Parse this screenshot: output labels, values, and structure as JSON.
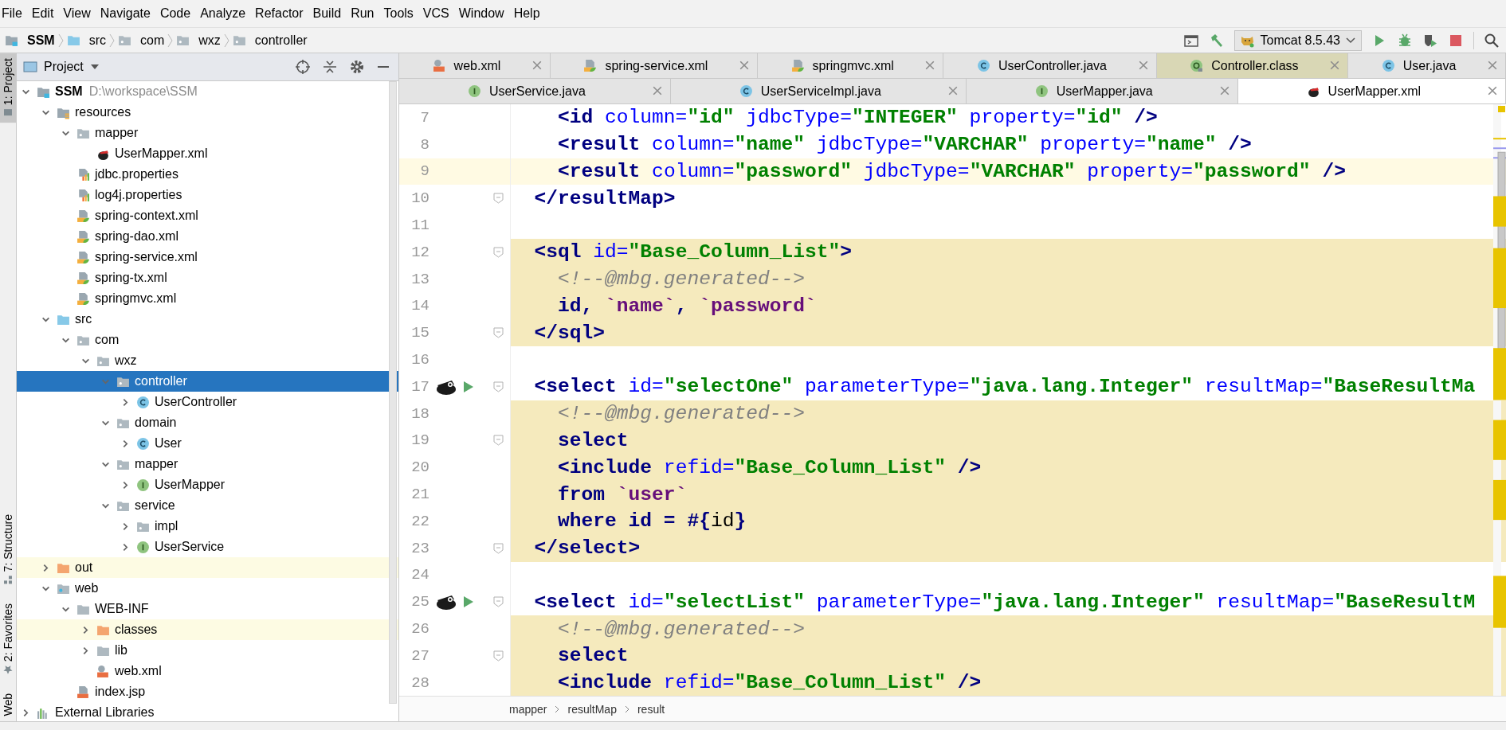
{
  "menu": [
    "File",
    "Edit",
    "View",
    "Navigate",
    "Code",
    "Analyze",
    "Refactor",
    "Build",
    "Run",
    "Tools",
    "VCS",
    "Window",
    "Help"
  ],
  "navigation": [
    {
      "label": "SSM",
      "kind": "module"
    },
    {
      "label": "src",
      "kind": "source_folder"
    },
    {
      "label": "com",
      "kind": "package"
    },
    {
      "label": "wxz",
      "kind": "package"
    },
    {
      "label": "controller",
      "kind": "package"
    }
  ],
  "run_configuration": {
    "label": "Tomcat 8.5.43"
  },
  "left_strip": {
    "top": [
      {
        "label": "1: Project",
        "selected": true
      }
    ],
    "bottom": [
      {
        "label": "7: Structure",
        "selected": false
      },
      {
        "label": "2: Favorites",
        "selected": false
      },
      {
        "label": "Web",
        "selected": false
      }
    ]
  },
  "project_panel": {
    "title": "Project",
    "tree": [
      {
        "label": "SSM",
        "path": "D:\\workspace\\SSM",
        "kind": "module",
        "expanded": true,
        "selected": false,
        "excluded": false,
        "children": [
          {
            "label": "resources",
            "kind": "resource_folder",
            "expanded": true,
            "selected": false,
            "excluded": false,
            "children": [
              {
                "label": "mapper",
                "kind": "package",
                "expanded": true,
                "selected": false,
                "excluded": false,
                "children": [
                  {
                    "label": "UserMapper.xml",
                    "kind": "mybatis_xml",
                    "selected": false,
                    "excluded": false
                  }
                ]
              },
              {
                "label": "jdbc.properties",
                "kind": "properties",
                "selected": false,
                "excluded": false
              },
              {
                "label": "log4j.properties",
                "kind": "properties",
                "selected": false,
                "excluded": false
              },
              {
                "label": "spring-context.xml",
                "kind": "spring_xml",
                "selected": false,
                "excluded": false
              },
              {
                "label": "spring-dao.xml",
                "kind": "spring_xml",
                "selected": false,
                "excluded": false
              },
              {
                "label": "spring-service.xml",
                "kind": "spring_xml",
                "selected": false,
                "excluded": false
              },
              {
                "label": "spring-tx.xml",
                "kind": "spring_xml",
                "selected": false,
                "excluded": false
              },
              {
                "label": "springmvc.xml",
                "kind": "spring_xml",
                "selected": false,
                "excluded": false
              }
            ]
          },
          {
            "label": "src",
            "kind": "source_folder",
            "expanded": true,
            "selected": false,
            "excluded": false,
            "children": [
              {
                "label": "com",
                "kind": "package",
                "expanded": true,
                "selected": false,
                "excluded": false,
                "children": [
                  {
                    "label": "wxz",
                    "kind": "package",
                    "expanded": true,
                    "selected": false,
                    "excluded": false,
                    "children": [
                      {
                        "label": "controller",
                        "kind": "package",
                        "expanded": true,
                        "selected": true,
                        "excluded": false,
                        "children": [
                          {
                            "label": "UserController",
                            "kind": "class",
                            "expanded": false,
                            "selected": false,
                            "excluded": false
                          }
                        ]
                      },
                      {
                        "label": "domain",
                        "kind": "package",
                        "expanded": true,
                        "selected": false,
                        "excluded": false,
                        "children": [
                          {
                            "label": "User",
                            "kind": "class",
                            "expanded": false,
                            "selected": false,
                            "excluded": false
                          }
                        ]
                      },
                      {
                        "label": "mapper",
                        "kind": "package",
                        "expanded": true,
                        "selected": false,
                        "excluded": false,
                        "children": [
                          {
                            "label": "UserMapper",
                            "kind": "interface",
                            "expanded": false,
                            "selected": false,
                            "excluded": false
                          }
                        ]
                      },
                      {
                        "label": "service",
                        "kind": "package",
                        "expanded": true,
                        "selected": false,
                        "excluded": false,
                        "children": [
                          {
                            "label": "impl",
                            "kind": "package",
                            "expanded": false,
                            "selected": false,
                            "excluded": false
                          },
                          {
                            "label": "UserService",
                            "kind": "interface",
                            "expanded": false,
                            "selected": false,
                            "excluded": false
                          }
                        ]
                      }
                    ]
                  }
                ]
              }
            ]
          },
          {
            "label": "out",
            "kind": "excluded_folder",
            "expanded": false,
            "selected": false,
            "excluded": true
          },
          {
            "label": "web",
            "kind": "web_folder",
            "expanded": true,
            "selected": false,
            "excluded": false,
            "children": [
              {
                "label": "WEB-INF",
                "kind": "folder",
                "expanded": true,
                "selected": false,
                "excluded": false,
                "children": [
                  {
                    "label": "classes",
                    "kind": "excluded_folder",
                    "expanded": false,
                    "selected": false,
                    "excluded": true
                  },
                  {
                    "label": "lib",
                    "kind": "folder",
                    "expanded": false,
                    "selected": false,
                    "excluded": false
                  },
                  {
                    "label": "web.xml",
                    "kind": "web_xml",
                    "selected": false,
                    "excluded": false
                  }
                ]
              },
              {
                "label": "index.jsp",
                "kind": "jsp",
                "selected": false,
                "excluded": false
              }
            ]
          }
        ]
      },
      {
        "label": "External Libraries",
        "kind": "libraries",
        "expanded": false,
        "selected": false,
        "excluded": false
      }
    ]
  },
  "editor": {
    "tab_rows": [
      [
        {
          "label": "web.xml",
          "kind": "web_xml",
          "selected": false
        },
        {
          "label": "spring-service.xml",
          "kind": "spring_xml",
          "selected": false
        },
        {
          "label": "springmvc.xml",
          "kind": "spring_xml",
          "selected": false
        },
        {
          "label": "UserController.java",
          "kind": "class",
          "selected": false
        },
        {
          "label": "Controller.class",
          "kind": "compiled_annotation",
          "selected": false
        },
        {
          "label": "User.java",
          "kind": "class",
          "selected": false
        }
      ],
      [
        {
          "label": "UserService.java",
          "kind": "interface",
          "selected": false
        },
        {
          "label": "UserServiceImpl.java",
          "kind": "class",
          "selected": false
        },
        {
          "label": "UserMapper.java",
          "kind": "interface",
          "selected": false
        },
        {
          "label": "UserMapper.xml",
          "kind": "mybatis_xml",
          "selected": true
        }
      ]
    ],
    "lines": [
      {
        "number": "7",
        "current_line": false,
        "sql_highlight": false,
        "fold_marker": false,
        "run_marker": false,
        "tokens": [
          {
            "kind": "tag",
            "text": "    <id"
          },
          {
            "kind": "attr",
            "text": " column="
          },
          {
            "kind": "value",
            "text": "\"id\""
          },
          {
            "kind": "attr",
            "text": " jdbcType="
          },
          {
            "kind": "value",
            "text": "\"INTEGER\""
          },
          {
            "kind": "attr",
            "text": " property="
          },
          {
            "kind": "value",
            "text": "\"id\""
          },
          {
            "kind": "tag",
            "text": " />"
          }
        ]
      },
      {
        "number": "8",
        "current_line": false,
        "sql_highlight": false,
        "fold_marker": false,
        "run_marker": false,
        "tokens": [
          {
            "kind": "tag",
            "text": "    <result"
          },
          {
            "kind": "attr",
            "text": " column="
          },
          {
            "kind": "value",
            "text": "\"name\""
          },
          {
            "kind": "attr",
            "text": " jdbcType="
          },
          {
            "kind": "value",
            "text": "\"VARCHAR\""
          },
          {
            "kind": "attr",
            "text": " property="
          },
          {
            "kind": "value",
            "text": "\"name\""
          },
          {
            "kind": "tag",
            "text": " />"
          }
        ]
      },
      {
        "number": "9",
        "current_line": true,
        "sql_highlight": false,
        "fold_marker": false,
        "run_marker": false,
        "tokens": [
          {
            "kind": "tag",
            "text": "    <result"
          },
          {
            "kind": "attr",
            "text": " column="
          },
          {
            "kind": "value",
            "text": "\"password\""
          },
          {
            "kind": "attr",
            "text": " jdbcType="
          },
          {
            "kind": "value",
            "text": "\"VARCHAR\""
          },
          {
            "kind": "attr",
            "text": " property="
          },
          {
            "kind": "value",
            "text": "\"password\""
          },
          {
            "kind": "tag",
            "text": " />"
          }
        ]
      },
      {
        "number": "10",
        "current_line": false,
        "sql_highlight": false,
        "fold_marker": true,
        "run_marker": false,
        "tokens": [
          {
            "kind": "tag",
            "text": "  </resultMap>"
          }
        ]
      },
      {
        "number": "11",
        "current_line": false,
        "sql_highlight": false,
        "fold_marker": false,
        "run_marker": false
      },
      {
        "number": "12",
        "current_line": false,
        "sql_highlight": true,
        "fold_marker": true,
        "run_marker": false,
        "tokens": [
          {
            "kind": "tag",
            "text": "  <sql"
          },
          {
            "kind": "attr",
            "text": " id="
          },
          {
            "kind": "value",
            "text": "\"Base_Column_List\""
          },
          {
            "kind": "tag",
            "text": ">"
          }
        ]
      },
      {
        "number": "13",
        "current_line": false,
        "sql_highlight": true,
        "fold_marker": false,
        "run_marker": false,
        "tokens": [
          {
            "kind": "comment",
            "text": "    <!--@mbg.generated-->"
          }
        ]
      },
      {
        "number": "14",
        "current_line": false,
        "sql_highlight": true,
        "fold_marker": false,
        "run_marker": false,
        "tokens": [
          {
            "kind": "keyword",
            "text": "    id, "
          },
          {
            "kind": "identifier",
            "text": "`name`"
          },
          {
            "kind": "keyword",
            "text": ", "
          },
          {
            "kind": "identifier",
            "text": "`password`"
          }
        ]
      },
      {
        "number": "15",
        "current_line": false,
        "sql_highlight": true,
        "fold_marker": true,
        "run_marker": false,
        "tokens": [
          {
            "kind": "tag",
            "text": "  </sql>"
          }
        ]
      },
      {
        "number": "16",
        "current_line": false,
        "sql_highlight": false,
        "fold_marker": false,
        "run_marker": false
      },
      {
        "number": "17",
        "current_line": false,
        "sql_highlight": false,
        "fold_marker": true,
        "run_marker": true,
        "tokens": [
          {
            "kind": "tag",
            "text": "  <select"
          },
          {
            "kind": "attr",
            "text": " id="
          },
          {
            "kind": "value",
            "text": "\"selectOne\""
          },
          {
            "kind": "attr",
            "text": " parameterType="
          },
          {
            "kind": "value",
            "text": "\"java.lang.Integer\""
          },
          {
            "kind": "attr",
            "text": " resultMap="
          },
          {
            "kind": "value",
            "text": "\"BaseResultMa"
          }
        ]
      },
      {
        "number": "18",
        "current_line": false,
        "sql_highlight": true,
        "fold_marker": false,
        "run_marker": false,
        "tokens": [
          {
            "kind": "comment",
            "text": "    <!--@mbg.generated-->"
          }
        ]
      },
      {
        "number": "19",
        "current_line": false,
        "sql_highlight": true,
        "fold_marker": true,
        "run_marker": false,
        "tokens": [
          {
            "kind": "keyword",
            "text": "    select"
          }
        ]
      },
      {
        "number": "20",
        "current_line": false,
        "sql_highlight": true,
        "fold_marker": false,
        "run_marker": false,
        "tokens": [
          {
            "kind": "tag",
            "text": "    <include"
          },
          {
            "kind": "attr",
            "text": " refid="
          },
          {
            "kind": "value",
            "text": "\"Base_Column_List\""
          },
          {
            "kind": "tag",
            "text": " />"
          }
        ]
      },
      {
        "number": "21",
        "current_line": false,
        "sql_highlight": true,
        "fold_marker": false,
        "run_marker": false,
        "tokens": [
          {
            "kind": "keyword",
            "text": "    from "
          },
          {
            "kind": "identifier",
            "text": "`user`"
          }
        ]
      },
      {
        "number": "22",
        "current_line": false,
        "sql_highlight": true,
        "fold_marker": false,
        "run_marker": false,
        "tokens": [
          {
            "kind": "keyword",
            "text": "    where id = #{"
          },
          {
            "kind": "plain",
            "text": "id"
          },
          {
            "kind": "keyword",
            "text": "}"
          }
        ]
      },
      {
        "number": "23",
        "current_line": false,
        "sql_highlight": true,
        "fold_marker": true,
        "run_marker": false,
        "tokens": [
          {
            "kind": "tag",
            "text": "  </select>"
          }
        ]
      },
      {
        "number": "24",
        "current_line": false,
        "sql_highlight": false,
        "fold_marker": false,
        "run_marker": false
      },
      {
        "number": "25",
        "current_line": false,
        "sql_highlight": false,
        "fold_marker": true,
        "run_marker": true,
        "tokens": [
          {
            "kind": "tag",
            "text": "  <select"
          },
          {
            "kind": "attr",
            "text": " id="
          },
          {
            "kind": "value",
            "text": "\"selectList\""
          },
          {
            "kind": "attr",
            "text": " parameterType="
          },
          {
            "kind": "value",
            "text": "\"java.lang.Integer\""
          },
          {
            "kind": "attr",
            "text": " resultMap="
          },
          {
            "kind": "value",
            "text": "\"BaseResultM"
          }
        ]
      },
      {
        "number": "26",
        "current_line": false,
        "sql_highlight": true,
        "fold_marker": false,
        "run_marker": false,
        "tokens": [
          {
            "kind": "comment",
            "text": "    <!--@mbg.generated-->"
          }
        ]
      },
      {
        "number": "27",
        "current_line": false,
        "sql_highlight": true,
        "fold_marker": true,
        "run_marker": false,
        "tokens": [
          {
            "kind": "keyword",
            "text": "    select"
          }
        ]
      },
      {
        "number": "28",
        "current_line": false,
        "sql_highlight": true,
        "fold_marker": false,
        "run_marker": false,
        "tokens": [
          {
            "kind": "tag",
            "text": "    <include"
          },
          {
            "kind": "attr",
            "text": " refid="
          },
          {
            "kind": "value",
            "text": "\"Base_Column_List\""
          },
          {
            "kind": "tag",
            "text": " />"
          }
        ]
      }
    ],
    "breadcrumbs": [
      "mapper",
      "resultMap",
      "result"
    ]
  }
}
